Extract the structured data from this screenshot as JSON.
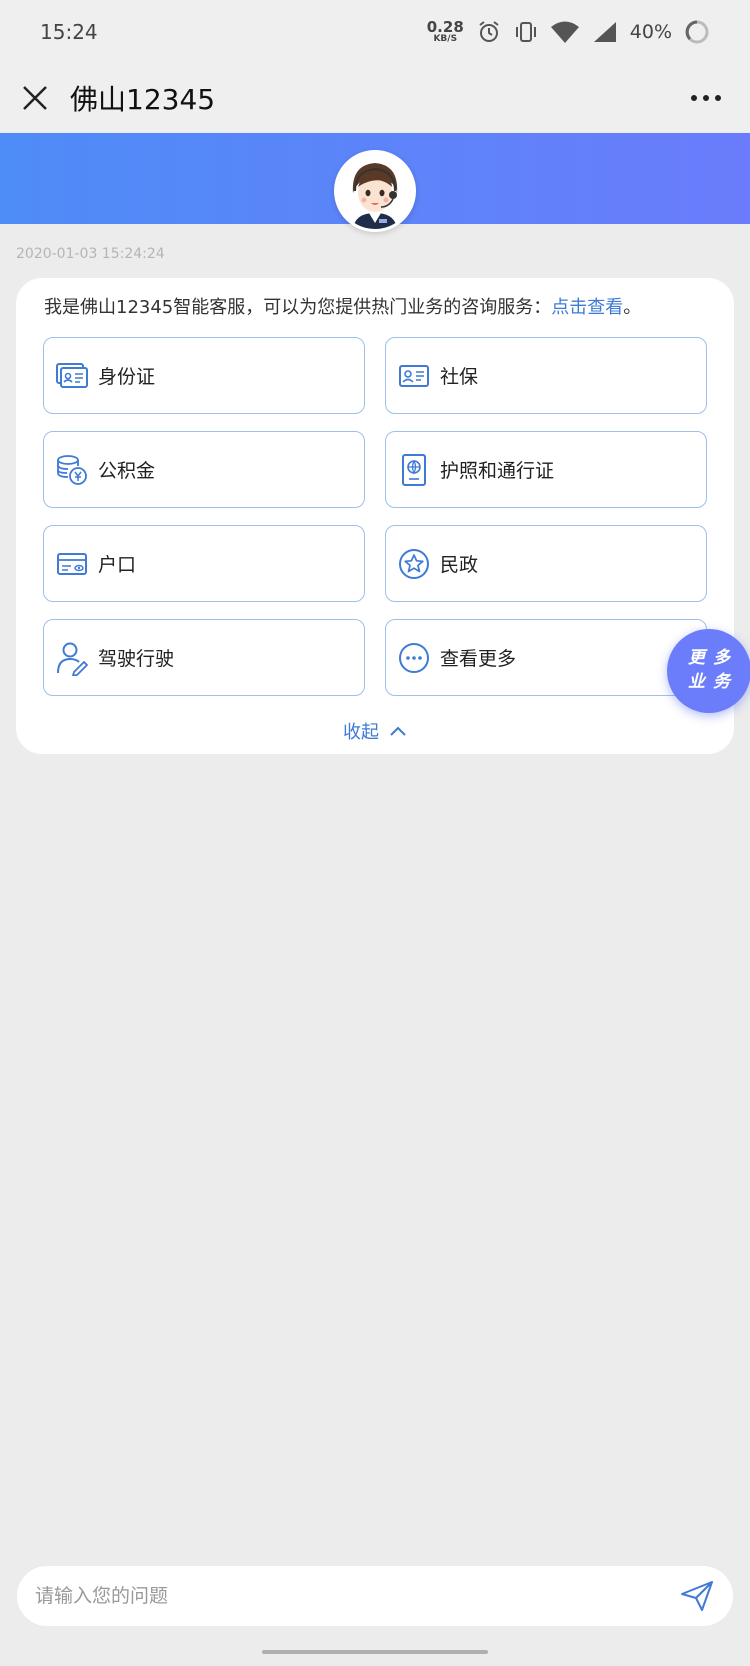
{
  "status_bar": {
    "time": "15:24",
    "net_speed_value": "0.28",
    "net_speed_unit": "KB/S",
    "battery": "40%",
    "icons": [
      "alarm-icon",
      "vibrate-icon",
      "wifi-icon",
      "signal-icon",
      "battery-ring-icon"
    ]
  },
  "header": {
    "title": "佛山12345",
    "close_icon": "close-icon",
    "more_icon": "more-dots-icon"
  },
  "banner": {
    "gradient_start": "#4e8cf8",
    "gradient_end": "#6a7cfb",
    "avatar": "customer-service-agent-avatar"
  },
  "chat": {
    "timestamp": "2020-01-03 15:24:24",
    "intro_text": "我是佛山12345智能客服，可以为您提供热门业务的咨询服务：",
    "intro_link": "点击查看",
    "intro_end": "。",
    "services": [
      {
        "label": "身份证",
        "icon": "id-card-icon"
      },
      {
        "label": "社保",
        "icon": "social-security-card-icon"
      },
      {
        "label": "公积金",
        "icon": "coins-yen-icon"
      },
      {
        "label": "护照和通行证",
        "icon": "passport-icon"
      },
      {
        "label": "户口",
        "icon": "household-card-icon"
      },
      {
        "label": "民政",
        "icon": "star-badge-icon"
      },
      {
        "label": "驾驶行驶",
        "icon": "driver-person-icon"
      },
      {
        "label": "查看更多",
        "icon": "more-circle-icon"
      }
    ],
    "collapse_label": "收起"
  },
  "fab": {
    "line1": "更多",
    "line2": "业务",
    "color": "#6b7dfa"
  },
  "input": {
    "placeholder": "请输入您的问题",
    "send_icon": "send-icon"
  },
  "colors": {
    "accent": "#3e7ad6",
    "border": "#9ec0ea",
    "background": "#ececec"
  }
}
